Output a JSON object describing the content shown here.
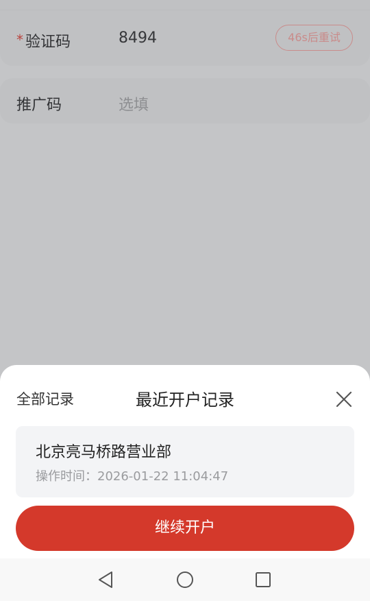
{
  "form": {
    "verification": {
      "required_mark": "*",
      "label": "验证码",
      "value": "8494",
      "resend_label": "46s后重试"
    },
    "promo_code": {
      "label": "推广码",
      "placeholder": "选填"
    }
  },
  "sheet": {
    "all_records_label": "全部记录",
    "title": "最近开户记录",
    "close_icon": "close-icon",
    "record": {
      "branch_name": "北京亮马桥路营业部",
      "time_label": "操作时间：",
      "time_value": "2026-01-22 11:04:47"
    },
    "continue_label": "继续开户"
  },
  "nav": {
    "back_icon": "triangle-back-icon",
    "home_icon": "circle-home-icon",
    "recents_icon": "square-recents-icon"
  },
  "colors": {
    "accent": "#d4392b",
    "overlay": "#c4c5c7",
    "resend_outline": "#c98b8a"
  }
}
